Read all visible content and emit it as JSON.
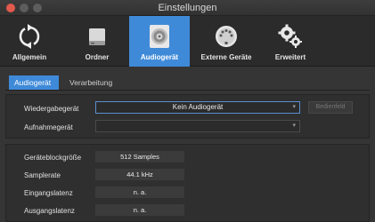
{
  "window": {
    "title": "Einstellungen"
  },
  "toolbar": {
    "items": [
      {
        "label": "Allgemein",
        "icon": "sync-icon",
        "active": false
      },
      {
        "label": "Ordner",
        "icon": "drive-icon",
        "active": false
      },
      {
        "label": "Audiogerät",
        "icon": "speaker-icon",
        "active": true
      },
      {
        "label": "Externe Geräte",
        "icon": "din-connector-icon",
        "active": false
      },
      {
        "label": "Erweitert",
        "icon": "gears-icon",
        "active": false
      }
    ],
    "accent": "#3f8ad8"
  },
  "tabs": [
    {
      "label": "Audiogerät",
      "active": true
    },
    {
      "label": "Verarbeitung",
      "active": false
    }
  ],
  "device": {
    "playback_label": "Wiedergabegerät",
    "playback_value": "Kein Audiogerät",
    "control_panel_button": "Bedienfeld",
    "record_label": "Aufnahmegerät",
    "record_value": ""
  },
  "settings": {
    "rows": [
      {
        "label": "Geräteblockgröße",
        "value": "512 Samples"
      },
      {
        "label": "Samplerate",
        "value": "44.1 kHz"
      },
      {
        "label": "Eingangslatenz",
        "value": "n. a."
      },
      {
        "label": "Ausgangslatenz",
        "value": "n. a."
      }
    ]
  }
}
